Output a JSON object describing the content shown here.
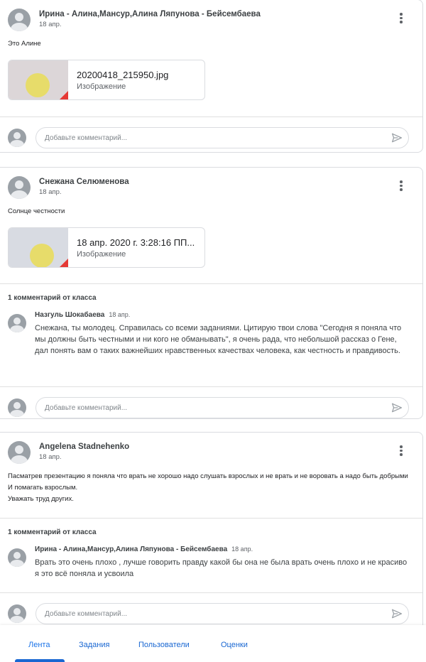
{
  "posts": [
    {
      "author": "Ирина - Алина,Мансур,Алина Ляпунова - Бейсембаева",
      "date": "18 апр.",
      "text": "Это Алине",
      "attachment": {
        "title": "20200418_215950.jpg",
        "type": "Изображение"
      },
      "comment_placeholder": "Добавьте комментарий..."
    },
    {
      "author": "Снежана Селюменова",
      "date": "18 апр.",
      "text": "Солнце честности",
      "attachment": {
        "title": "18 апр. 2020 г. 3:28:16 ПП...",
        "type": "Изображение"
      },
      "class_comments_title": "1 комментарий от класса",
      "class_comment": {
        "author": "Назгуль Шокабаева",
        "date": "18 апр.",
        "text": "Снежана, ты молодец. Справилась со всеми заданиями. Цитирую твои слова \"Сегодня я поняла что мы должны быть честными и ни кого не обманывать\", я очень рада, что небольшой рассказ о Гене, дал понять вам о таких важнейших нравственных качествах человека, как честность и правдивость."
      },
      "comment_placeholder": "Добавьте комментарий..."
    },
    {
      "author": "Angelena Stadnehenko",
      "date": "18 апр.",
      "text_lines": [
        "Пасматрев презентацию я поняла что врать не хорошо надо слушать взрослых и не врать и не воровать а надо быть добрыми",
        "И помагать взрослым.",
        "Уважать труд других."
      ],
      "class_comments_title": "1 комментарий от класса",
      "class_comment": {
        "author": "Ирина - Алина,Мансур,Алина Ляпунова - Бейсембаева",
        "date": "18 апр.",
        "text": "Врать это очень плохо , лучше говорить правду какой бы она не была врать очень плохо и не красиво я это всё поняла и усвоила"
      },
      "comment_placeholder": "Добавьте комментарий..."
    }
  ],
  "nav": {
    "tabs": [
      "Лента",
      "Задания",
      "Пользователи",
      "Оценки"
    ],
    "active": "Лента"
  },
  "colors": {
    "accent": "#1967d2",
    "border": "#dadce0",
    "text": "#202124",
    "muted": "#5f6368"
  }
}
